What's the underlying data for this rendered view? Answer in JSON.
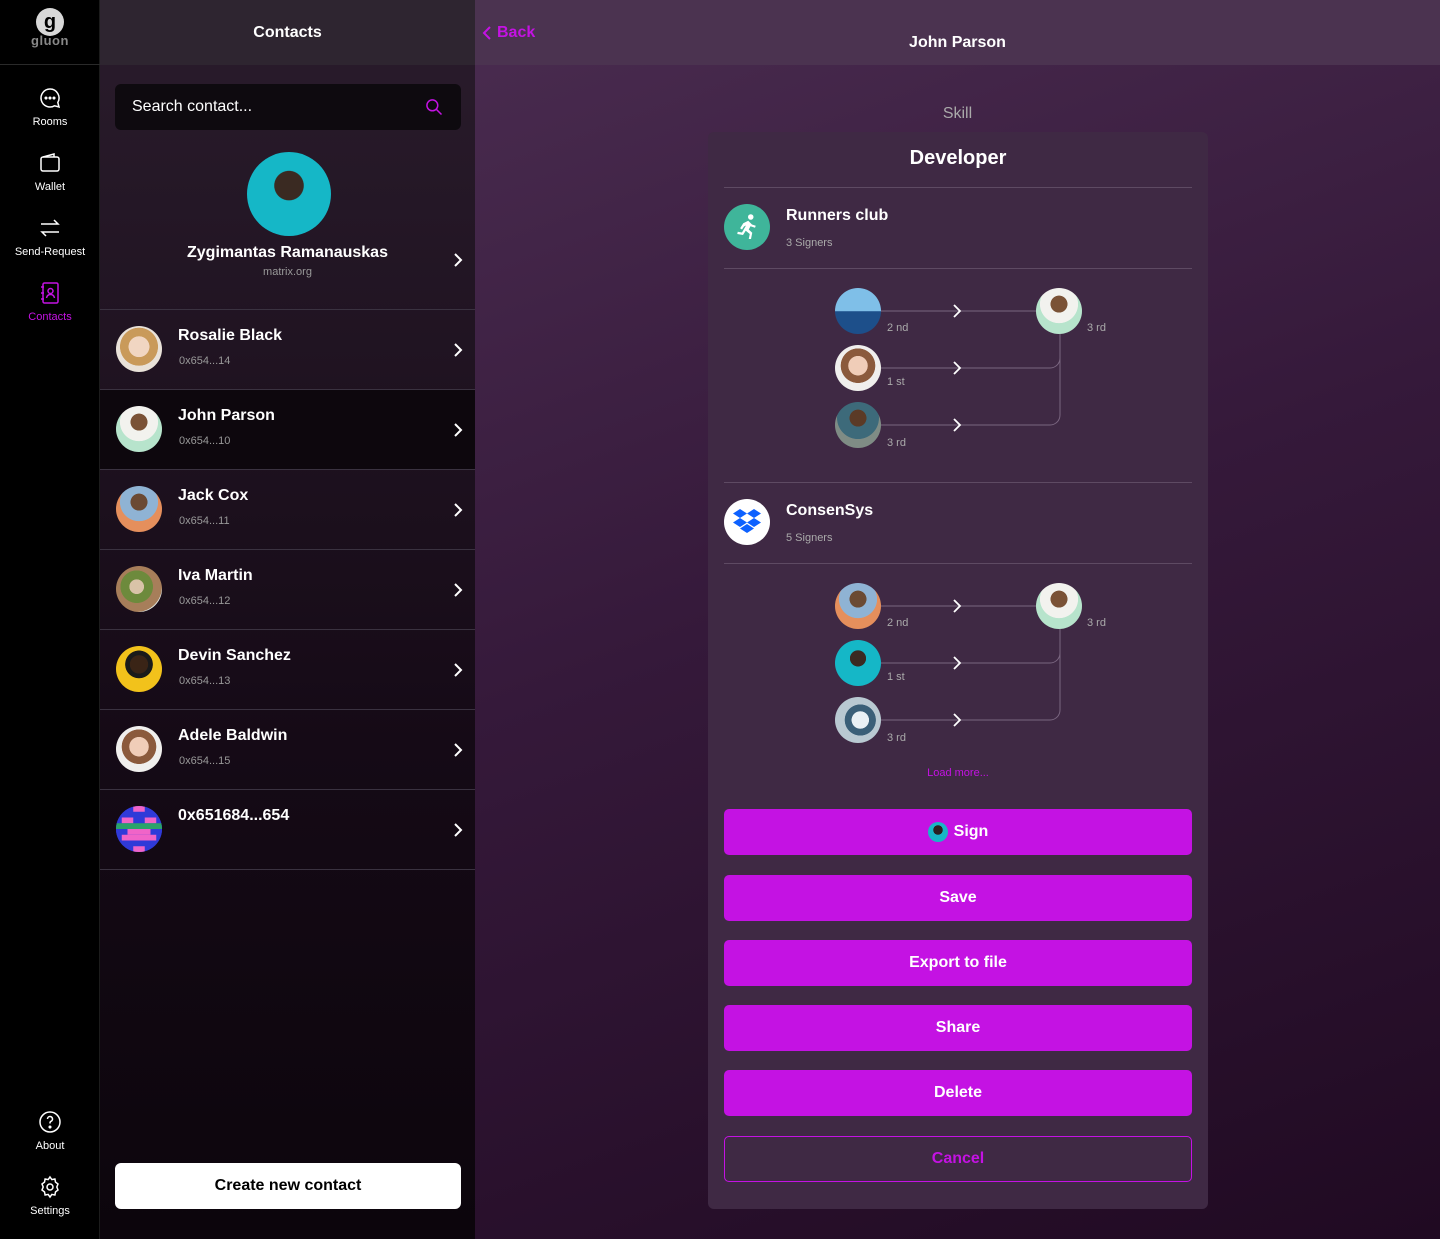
{
  "nav": {
    "logo_text": "gluon",
    "items": [
      {
        "label": "Rooms",
        "icon": "chat-bubble-icon"
      },
      {
        "label": "Wallet",
        "icon": "wallet-icon"
      },
      {
        "label": "Send-Request",
        "icon": "transfer-arrows-icon"
      },
      {
        "label": "Contacts",
        "icon": "contacts-icon"
      },
      {
        "label": "About",
        "icon": "help-circle-icon"
      },
      {
        "label": "Settings",
        "icon": "gear-icon"
      }
    ],
    "active": "Contacts",
    "accent": "#c412e3"
  },
  "contacts": {
    "title": "Contacts",
    "search_placeholder": "Search contact...",
    "me": {
      "name": "Zygimantas Ramanauskas",
      "server": "matrix.org"
    },
    "list": [
      {
        "name": "Rosalie Black",
        "address": "0x654...14"
      },
      {
        "name": "John Parson",
        "address": "0x654...10"
      },
      {
        "name": "Jack Cox",
        "address": "0x654...11"
      },
      {
        "name": "Iva Martin",
        "address": "0x654...12"
      },
      {
        "name": "Devin Sanchez",
        "address": "0x654...13"
      },
      {
        "name": "Adele Baldwin",
        "address": "0x654...15"
      },
      {
        "name": "0x651684...654",
        "address": ""
      }
    ],
    "selected": "John Parson",
    "create_label": "Create new contact"
  },
  "detail": {
    "back_label": "Back",
    "title": "John Parson",
    "skill_label": "Skill",
    "skill_name": "Developer",
    "orgs": [
      {
        "name": "Runners club",
        "signers": "3 Signers",
        "chain": [
          {
            "label": "2 nd"
          },
          {
            "label": "1 st"
          },
          {
            "label": "3 rd"
          }
        ],
        "target_label": "3 rd"
      },
      {
        "name": "ConsenSys",
        "signers": "5 Signers",
        "chain": [
          {
            "label": "2 nd"
          },
          {
            "label": "1 st"
          },
          {
            "label": "3 rd"
          }
        ],
        "target_label": "3 rd"
      }
    ],
    "load_more": "Load more...",
    "buttons": {
      "sign": "Sign",
      "save": "Save",
      "export": "Export to file",
      "share": "Share",
      "delete": "Delete",
      "cancel": "Cancel"
    }
  }
}
